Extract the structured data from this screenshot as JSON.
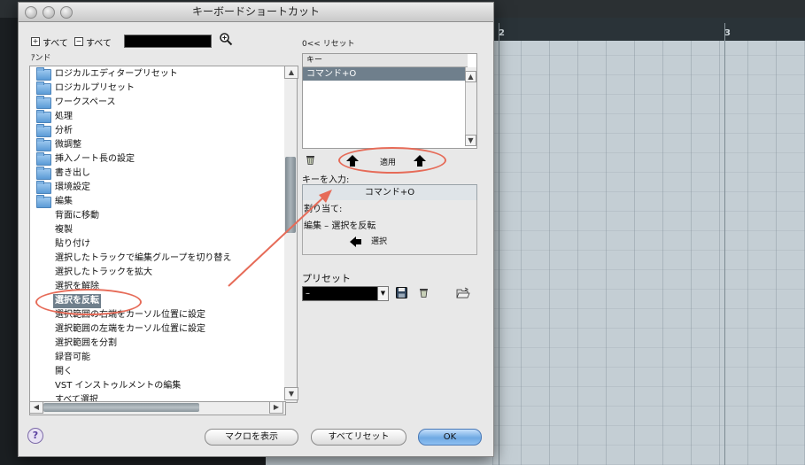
{
  "dialog": {
    "title": "キーボードショートカット"
  },
  "tree_controls": {
    "expand_label": "すべて",
    "collapse_label": "すべて",
    "expand_glyph": "+",
    "collapse_glyph": "−"
  },
  "command_header": "ｱンド",
  "commands": [
    {
      "label": "ロジカルエディタープリセット",
      "type": "folder"
    },
    {
      "label": "ロジカルプリセット",
      "type": "folder"
    },
    {
      "label": "ワークスペース",
      "type": "folder"
    },
    {
      "label": "処理",
      "type": "folder"
    },
    {
      "label": "分析",
      "type": "folder"
    },
    {
      "label": "微調整",
      "type": "folder"
    },
    {
      "label": "挿入ノート長の設定",
      "type": "folder"
    },
    {
      "label": "書き出し",
      "type": "folder"
    },
    {
      "label": "環境設定",
      "type": "folder"
    },
    {
      "label": "編集",
      "type": "folder"
    },
    {
      "label": "背面に移動",
      "type": "item"
    },
    {
      "label": "複製",
      "type": "item"
    },
    {
      "label": "貼り付け",
      "type": "item"
    },
    {
      "label": "選択したトラックで編集グループを切り替え",
      "type": "item"
    },
    {
      "label": "選択したトラックを拡大",
      "type": "item"
    },
    {
      "label": "選択を解除",
      "type": "item"
    },
    {
      "label": "選択を反転",
      "type": "item",
      "selected": true
    },
    {
      "label": "選択範囲の右端をカーソル位置に設定",
      "type": "item"
    },
    {
      "label": "選択範囲の左端をカーソル位置に設定",
      "type": "item"
    },
    {
      "label": "選択範囲を分割",
      "type": "item"
    },
    {
      "label": "録音可能",
      "type": "item"
    },
    {
      "label": "開く",
      "type": "item"
    },
    {
      "label": "VST インストゥルメントの編集",
      "type": "item"
    },
    {
      "label": "すべて選択",
      "type": "item"
    }
  ],
  "reset": {
    "label": "0<< リセット"
  },
  "keys": {
    "header": "キー",
    "items": [
      "コマンド+O"
    ]
  },
  "apply": {
    "label": "適用"
  },
  "key_input": {
    "label": "キーを入力:",
    "value": "コマンド+O"
  },
  "assignment": {
    "label": "割り当て:",
    "value": "編集 – 選択を反転",
    "select_label": "選択"
  },
  "preset": {
    "label": "プリセット",
    "value": "–"
  },
  "buttons": {
    "help": "?",
    "show_macros": "マクロを表示",
    "reset_all": "すべてリセット",
    "ok": "OK"
  },
  "timeline": {
    "markers": [
      "2",
      "3"
    ]
  },
  "colors": {
    "selection": "#6f7f8c",
    "annotation": "#e66b58",
    "ok_button": "#6fa9e3",
    "timeline_bg": "#c4ced4"
  }
}
